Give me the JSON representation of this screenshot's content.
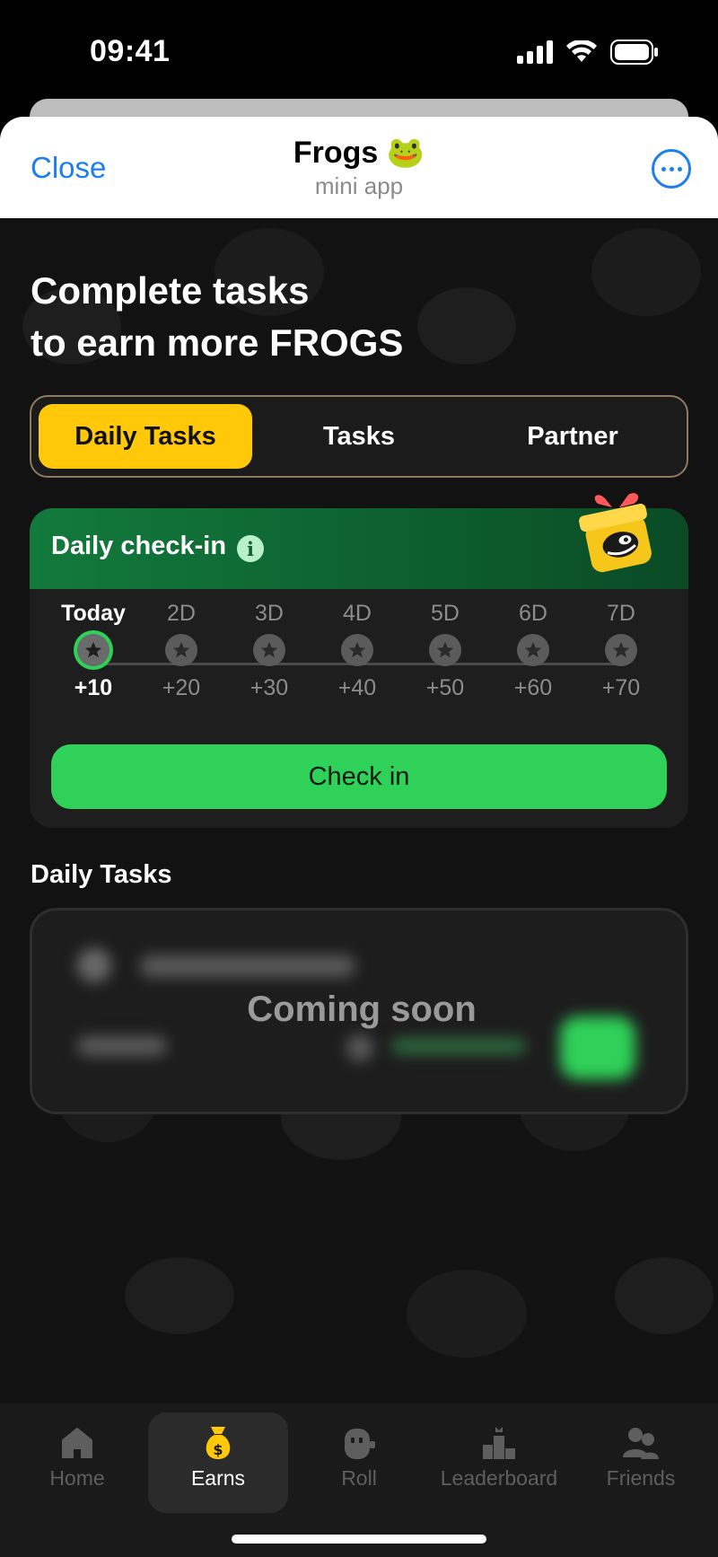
{
  "status": {
    "time": "09:41"
  },
  "header": {
    "close_label": "Close",
    "title": "Frogs 🐸",
    "subtitle": "mini app"
  },
  "headline": [
    "Complete tasks",
    "to earn more FROGS"
  ],
  "tabs": [
    {
      "label": "Daily Tasks",
      "active": true
    },
    {
      "label": "Tasks",
      "active": false
    },
    {
      "label": "Partner",
      "active": false
    }
  ],
  "checkin": {
    "title": "Daily check-in",
    "info_icon": "i",
    "days": [
      {
        "label": "Today",
        "reward": "+10"
      },
      {
        "label": "2D",
        "reward": "+20"
      },
      {
        "label": "3D",
        "reward": "+30"
      },
      {
        "label": "4D",
        "reward": "+40"
      },
      {
        "label": "5D",
        "reward": "+50"
      },
      {
        "label": "6D",
        "reward": "+60"
      },
      {
        "label": "7D",
        "reward": "+70"
      }
    ],
    "button_label": "Check in"
  },
  "daily_tasks": {
    "title": "Daily Tasks",
    "overlay": "Coming soon"
  },
  "nav": [
    {
      "label": "Home",
      "icon": "home-icon",
      "active": false
    },
    {
      "label": "Earns",
      "icon": "money-bag-icon",
      "active": true
    },
    {
      "label": "Roll",
      "icon": "robot-icon",
      "active": false
    },
    {
      "label": "Leaderboard",
      "icon": "podium-icon",
      "active": false
    },
    {
      "label": "Friends",
      "icon": "people-icon",
      "active": false
    }
  ],
  "colors": {
    "accent_yellow": "#ffc90a",
    "accent_green": "#2fd158",
    "link_blue": "#1c7ef0"
  }
}
